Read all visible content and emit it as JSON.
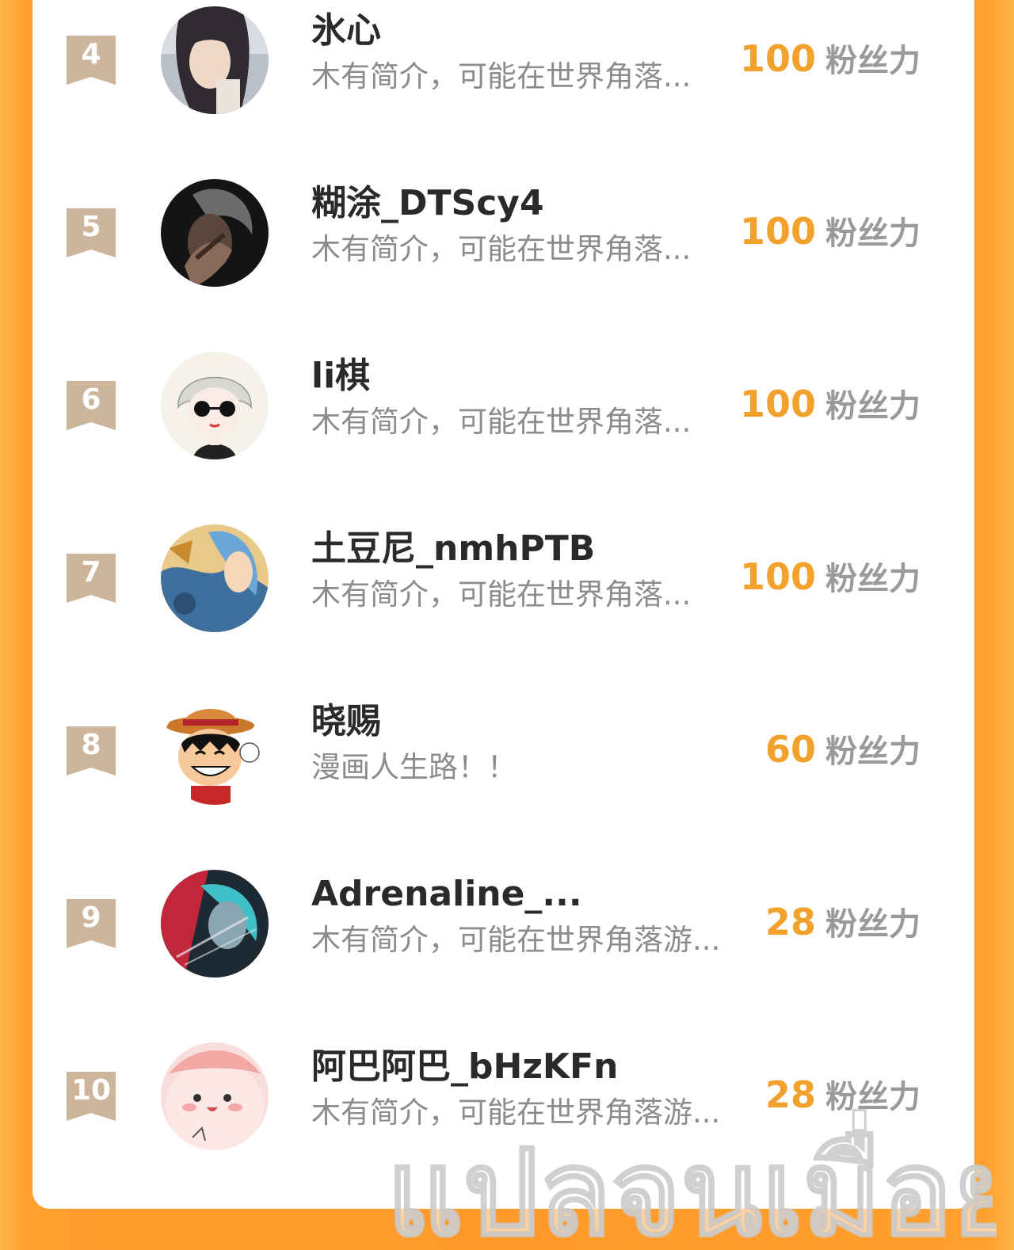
{
  "score_unit": "粉丝力",
  "colors": {
    "accent": "#f2a12d",
    "badge": "#cdb59c",
    "frame": "#ff9a2a"
  },
  "rows": [
    {
      "rank": "4",
      "name": "氷心",
      "bio": "木有简介，可能在世界角落...",
      "score": "100",
      "avatar": "portrait-long-hair"
    },
    {
      "rank": "5",
      "name": "糊涂_DTScy4",
      "bio": "木有简介，可能在世界角落...",
      "score": "100",
      "avatar": "portrait-dark-hand"
    },
    {
      "rank": "6",
      "name": "li棋",
      "bio": "木有简介，可能在世界角落...",
      "score": "100",
      "avatar": "cartoon-sunglasses"
    },
    {
      "rank": "7",
      "name": "土豆尼_nmhPTB",
      "bio": "木有简介，可能在世界角落...",
      "score": "100",
      "avatar": "illustration-blue"
    },
    {
      "rank": "8",
      "name": "晓赐",
      "bio": "漫画人生路！！",
      "score": "60",
      "avatar": "cartoon-straw-hat"
    },
    {
      "rank": "9",
      "name": "Adrenaline_...",
      "bio": "木有简介，可能在世界角落游...",
      "score": "28",
      "avatar": "photo-neon"
    },
    {
      "rank": "10",
      "name": "阿巴阿巴_bHzKFn",
      "bio": "木有简介，可能在世界角落游...",
      "score": "28",
      "avatar": "cartoon-pink-blob"
    }
  ],
  "watermark_text": "แปลจนเมื่อย"
}
